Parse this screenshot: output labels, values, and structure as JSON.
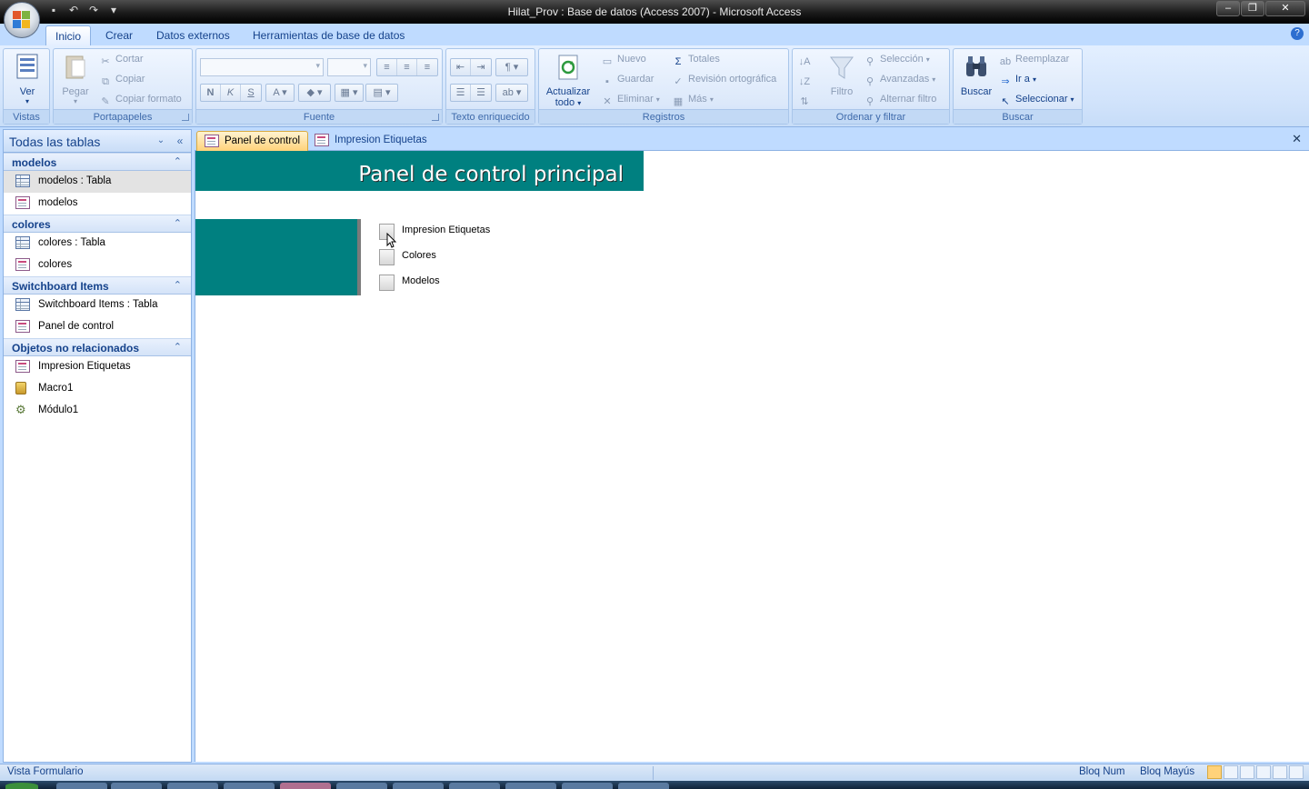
{
  "window": {
    "title": "Hilat_Prov : Base de datos (Access 2007) - Microsoft Access"
  },
  "ribbon_tabs": [
    "Inicio",
    "Crear",
    "Datos externos",
    "Herramientas de base de datos"
  ],
  "ribbon": {
    "vistas": {
      "ver_label": "Ver",
      "group_label": "Vistas"
    },
    "portapapeles": {
      "pegar": "Pegar",
      "cortar": "Cortar",
      "copiar": "Copiar",
      "copiar_formato": "Copiar formato",
      "group_label": "Portapapeles"
    },
    "fuente": {
      "group_label": "Fuente",
      "bold": "N",
      "italic": "K",
      "underline": "S"
    },
    "texto_enriquecido": {
      "group_label": "Texto enriquecido"
    },
    "registros": {
      "actualizar": "Actualizar",
      "actualizar2": "todo",
      "nuevo": "Nuevo",
      "guardar": "Guardar",
      "eliminar": "Eliminar",
      "totales": "Totales",
      "revision": "Revisión ortográfica",
      "mas": "Más",
      "group_label": "Registros"
    },
    "ordenar": {
      "filtro": "Filtro",
      "seleccion": "Selección",
      "avanzadas": "Avanzadas",
      "alternar": "Alternar filtro",
      "group_label": "Ordenar y filtrar"
    },
    "buscar": {
      "buscar": "Buscar",
      "reemplazar": "Reemplazar",
      "ir_a": "Ir a",
      "seleccionar": "Seleccionar",
      "group_label": "Buscar"
    }
  },
  "nav": {
    "title": "Todas las tablas",
    "groups": [
      {
        "label": "modelos",
        "items": [
          {
            "label": "modelos : Tabla",
            "type": "table"
          },
          {
            "label": "modelos",
            "type": "form"
          }
        ]
      },
      {
        "label": "colores",
        "items": [
          {
            "label": "colores : Tabla",
            "type": "table"
          },
          {
            "label": "colores",
            "type": "form"
          }
        ]
      },
      {
        "label": "Switchboard Items",
        "items": [
          {
            "label": "Switchboard Items : Tabla",
            "type": "table"
          },
          {
            "label": "Panel de control",
            "type": "form"
          }
        ]
      },
      {
        "label": "Objetos no relacionados",
        "items": [
          {
            "label": "Impresion Etiquetas",
            "type": "form"
          },
          {
            "label": "Macro1",
            "type": "macro"
          },
          {
            "label": "Módulo1",
            "type": "module"
          }
        ]
      }
    ]
  },
  "doc_tabs": [
    "Panel de control",
    "Impresion Etiquetas"
  ],
  "form": {
    "title": "Panel de control principal",
    "buttons": [
      "Impresion Etiquetas",
      "Colores",
      "Modelos"
    ]
  },
  "status": {
    "left": "Vista Formulario",
    "num": "Bloq Num",
    "caps": "Bloq Mayús"
  },
  "colors": {
    "teal": "#008080",
    "ribbon": "#bfdbff",
    "active_tab": "#ffd27a"
  }
}
